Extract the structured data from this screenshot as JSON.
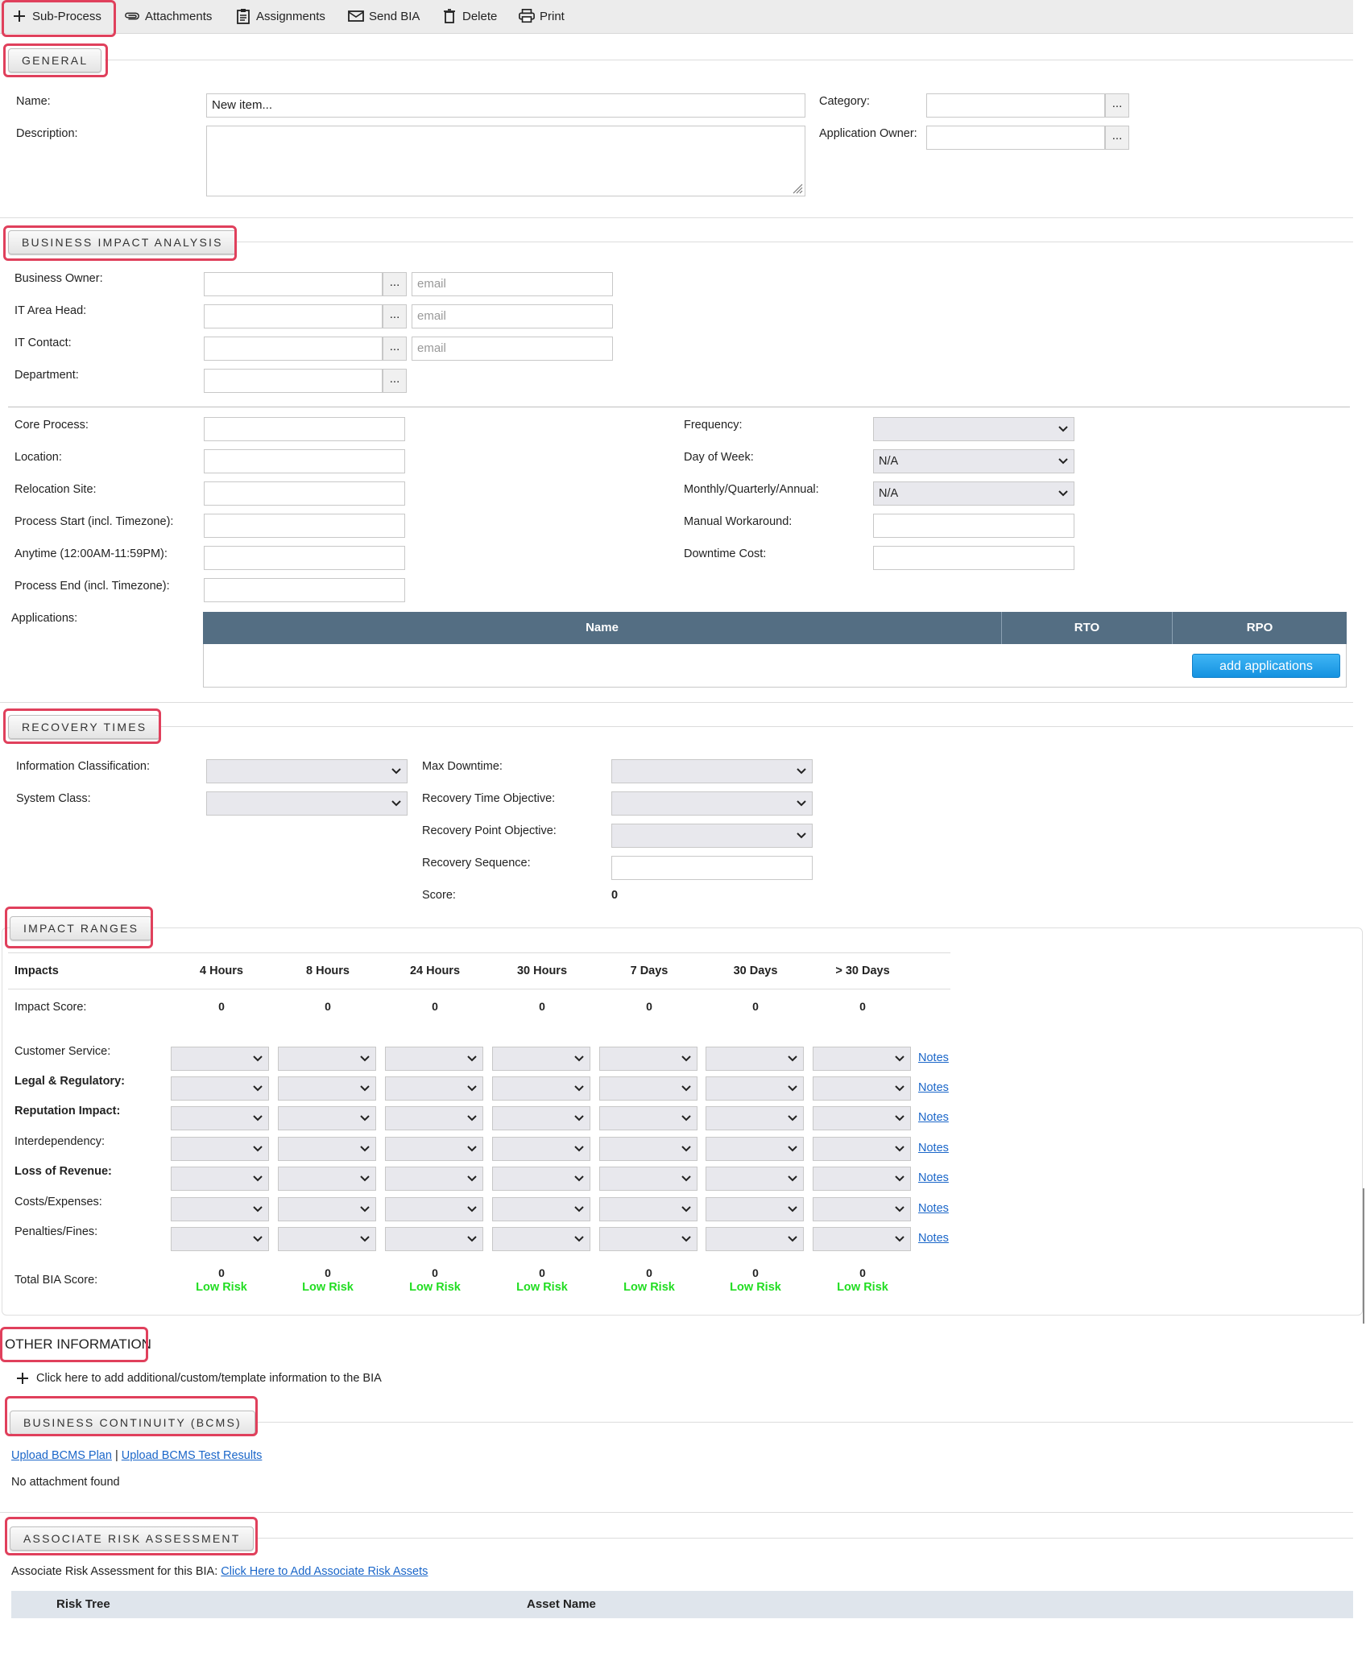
{
  "toolbar": {
    "sub_process": "Sub-Process",
    "attachments": "Attachments",
    "assignments": "Assignments",
    "send_bia": "Send BIA",
    "delete": "Delete",
    "print": "Print"
  },
  "general": {
    "title": "GENERAL",
    "name_label": "Name:",
    "name_value": "New item...",
    "description_label": "Description:",
    "category_label": "Category:",
    "app_owner_label": "Application Owner:"
  },
  "bia": {
    "title": "BUSINESS IMPACT ANALYSIS",
    "business_owner_label": "Business Owner:",
    "it_area_head_label": "IT Area Head:",
    "it_contact_label": "IT Contact:",
    "department_label": "Department:",
    "email_placeholder": "email",
    "core_process_label": "Core Process:",
    "location_label": "Location:",
    "relocation_site_label": "Relocation Site:",
    "process_start_label": "Process Start (incl. Timezone):",
    "anytime_label": "Anytime (12:00AM-11:59PM):",
    "process_end_label": "Process End (incl. Timezone):",
    "applications_label": "Applications:",
    "frequency_label": "Frequency:",
    "frequency_value": "",
    "day_of_week_label": "Day of Week:",
    "day_of_week_value": "N/A",
    "mqa_label": "Monthly/Quarterly/Annual:",
    "mqa_value": "N/A",
    "manual_workaround_label": "Manual Workaround:",
    "downtime_cost_label": "Downtime Cost:",
    "apps_columns": [
      "Name",
      "RTO",
      "RPO"
    ],
    "add_applications": "add applications"
  },
  "recovery": {
    "title": "RECOVERY TIMES",
    "info_class_label": "Information Classification:",
    "system_class_label": "System Class:",
    "max_downtime_label": "Max Downtime:",
    "rto_label": "Recovery Time Objective:",
    "rpo_label": "Recovery Point Objective:",
    "sequence_label": "Recovery Sequence:",
    "score_label": "Score:",
    "score_value": "0"
  },
  "impact": {
    "title": "IMPACT RANGES",
    "impacts_header": "Impacts",
    "columns": [
      "4 Hours",
      "8 Hours",
      "24 Hours",
      "30 Hours",
      "7 Days",
      "30 Days",
      "> 30 Days"
    ],
    "impact_score_label": "Impact Score:",
    "impact_scores": [
      "0",
      "0",
      "0",
      "0",
      "0",
      "0",
      "0"
    ],
    "rows": [
      {
        "label": "Customer Service:",
        "bold": false
      },
      {
        "label": "Legal & Regulatory:",
        "bold": true
      },
      {
        "label": "Reputation Impact:",
        "bold": true
      },
      {
        "label": "Interdependency:",
        "bold": false
      },
      {
        "label": "Loss of Revenue:",
        "bold": true
      },
      {
        "label": "Costs/Expenses:",
        "bold": false
      },
      {
        "label": "Penalties/Fines:",
        "bold": false
      }
    ],
    "notes_label": "Notes",
    "total_label": "Total BIA Score:",
    "total_scores": [
      "0",
      "0",
      "0",
      "0",
      "0",
      "0",
      "0"
    ],
    "risk_label": "Low Risk",
    "risk_color": "#22dd22"
  },
  "other": {
    "title": "OTHER INFORMATION",
    "add_text": "Click here to add additional/custom/template information to the BIA"
  },
  "bcms": {
    "title": "BUSINESS CONTINUITY (BCMS)",
    "upload_plan": "Upload BCMS Plan",
    "separator": "|",
    "upload_test": "Upload BCMS Test Results",
    "no_attachment": "No attachment found"
  },
  "risk": {
    "title": "ASSOCIATE RISK ASSESSMENT",
    "intro": "Associate Risk Assessment for this BIA:",
    "link": "Click Here to Add Associate Risk Assets",
    "columns": [
      "Risk Tree",
      "Asset Name"
    ]
  },
  "colors": {
    "highlight": "#e0405c",
    "table_header": "#546e83",
    "link": "#1a66c9",
    "button_blue": "#1592e0"
  }
}
